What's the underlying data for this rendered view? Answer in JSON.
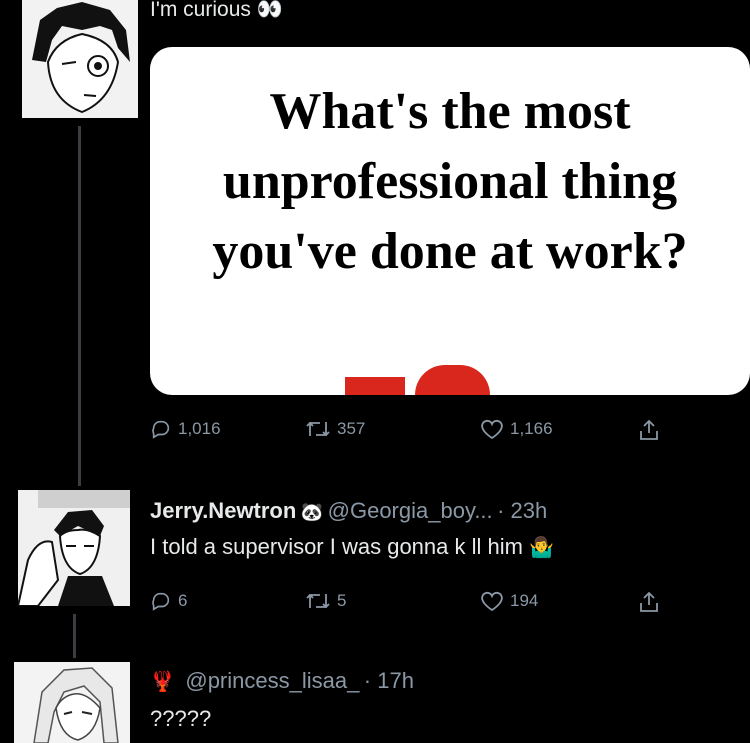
{
  "tweet1": {
    "text": "I'm curious",
    "emoji": "👀",
    "card_text": "What's the most unprofessional thing you've done at work?",
    "stats": {
      "replies": "1,016",
      "retweets": "357",
      "likes": "1,166"
    }
  },
  "tweet2": {
    "name": "Jerry.Newtron",
    "name_emoji": "🐼",
    "handle": "@Georgia_boy...",
    "time": "· 23h",
    "text": "I told a supervisor I was gonna k ll him",
    "text_emoji": "🤷‍♂️",
    "stats": {
      "replies": "6",
      "retweets": "5",
      "likes": "194"
    }
  },
  "tweet3": {
    "name_emoji": "🦞",
    "handle": "@princess_lisaa_",
    "time": "· 17h",
    "text": "?????"
  },
  "colors": {
    "background": "#000000",
    "muted": "#8b98a5",
    "text": "#e7e9ea"
  }
}
